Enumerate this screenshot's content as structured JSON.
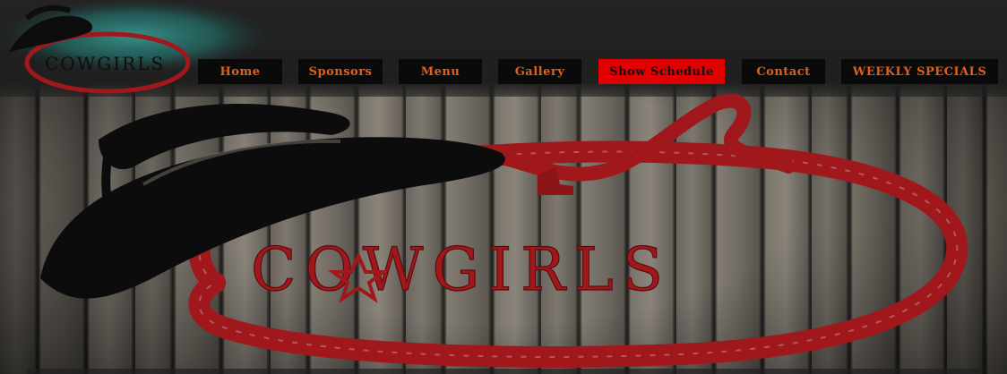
{
  "brand": {
    "logo_text": "COWGIRLS",
    "colors": {
      "rope_red": "#b3191c",
      "hat_black": "#0d0d0d",
      "teal": "#2f8f8a",
      "nav_text": "#e0601a",
      "nav_active_bg": "#e00000"
    }
  },
  "nav": {
    "items": [
      {
        "label": "Home"
      },
      {
        "label": "Sponsors"
      },
      {
        "label": "Menu"
      },
      {
        "label": "Gallery"
      },
      {
        "label": "Show Schedule",
        "active": true
      },
      {
        "label": "Contact"
      },
      {
        "label": "WEEKLY SPECIALS"
      }
    ]
  },
  "hero": {
    "logo_text": "COWGIRLS"
  }
}
